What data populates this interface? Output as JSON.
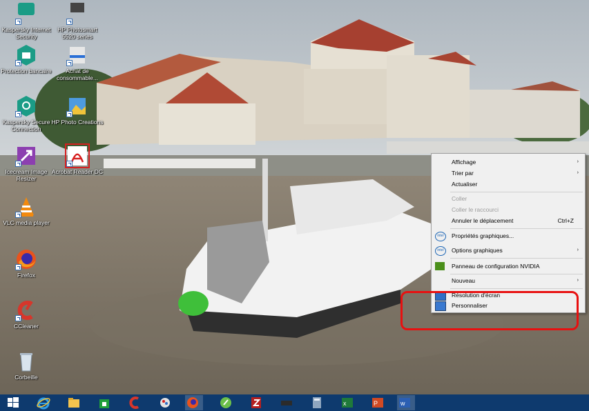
{
  "desktop": {
    "icons": [
      {
        "label": "Kaspersky Internet Security",
        "icon": "kaspersky-internet-security-icon"
      },
      {
        "label": "HP Photosmart 5520 series",
        "icon": "hp-printer-icon"
      },
      {
        "label": "Protection bancaire",
        "icon": "kaspersky-safe-money-icon"
      },
      {
        "label": "Achat de consommable...",
        "icon": "hp-supplies-icon"
      },
      {
        "label": "Kaspersky Secure Connection",
        "icon": "kaspersky-vpn-icon"
      },
      {
        "label": "HP Photo Creations",
        "icon": "hp-photo-creations-icon"
      },
      {
        "label": "Icecream Image Resizer",
        "icon": "icecream-resizer-icon"
      },
      {
        "label": "Acrobat Reader DC",
        "icon": "acrobat-reader-icon"
      },
      {
        "label": "VLC media player",
        "icon": "vlc-icon"
      },
      {
        "label": "Firefox",
        "icon": "firefox-icon"
      },
      {
        "label": "CCleaner",
        "icon": "ccleaner-icon"
      },
      {
        "label": "Corbeille",
        "icon": "recycle-bin-icon"
      }
    ]
  },
  "context_menu": {
    "items": [
      {
        "label": "Affichage",
        "submenu": true
      },
      {
        "label": "Trier par",
        "submenu": true
      },
      {
        "label": "Actualiser"
      },
      {
        "label": "Coller",
        "disabled": true
      },
      {
        "label": "Coller le raccourci",
        "disabled": true
      },
      {
        "label": "Annuler le déplacement",
        "shortcut": "Ctrl+Z"
      },
      {
        "label": "Propriétés graphiques...",
        "icon": "intel-graphics-icon"
      },
      {
        "label": "Options graphiques",
        "icon": "intel-graphics-icon",
        "submenu": true
      },
      {
        "label": "Panneau de configuration NVIDIA",
        "icon": "nvidia-icon"
      },
      {
        "label": "Nouveau",
        "submenu": true
      },
      {
        "label": "Résolution d'écran",
        "icon": "screen-resolution-icon"
      },
      {
        "label": "Personnaliser",
        "icon": "personalize-icon"
      }
    ],
    "submenu_arrow": "›",
    "intel_badge": "intel"
  },
  "annotation": {
    "color": "#e81010",
    "target": "Personnaliser"
  },
  "taskbar": {
    "items": [
      {
        "icon": "windows-start-icon"
      },
      {
        "icon": "internet-explorer-icon"
      },
      {
        "icon": "file-explorer-icon"
      },
      {
        "icon": "store-icon"
      },
      {
        "icon": "ccleaner-icon"
      },
      {
        "icon": "paint-icon"
      },
      {
        "icon": "firefox-icon",
        "active": true
      },
      {
        "icon": "green-app-icon"
      },
      {
        "icon": "filezilla-icon"
      },
      {
        "icon": "dark-device-icon"
      },
      {
        "icon": "calculator-icon"
      },
      {
        "icon": "excel-icon"
      },
      {
        "icon": "powerpoint-icon"
      },
      {
        "icon": "word-icon",
        "active": true
      }
    ],
    "excel_letter": "x",
    "powerpoint_letter": "P",
    "word_letter": "w"
  },
  "colors": {
    "taskbar": "#0e3a6e",
    "menu_bg": "#f0f0f0",
    "menu_disabled": "#9a9a9a"
  }
}
